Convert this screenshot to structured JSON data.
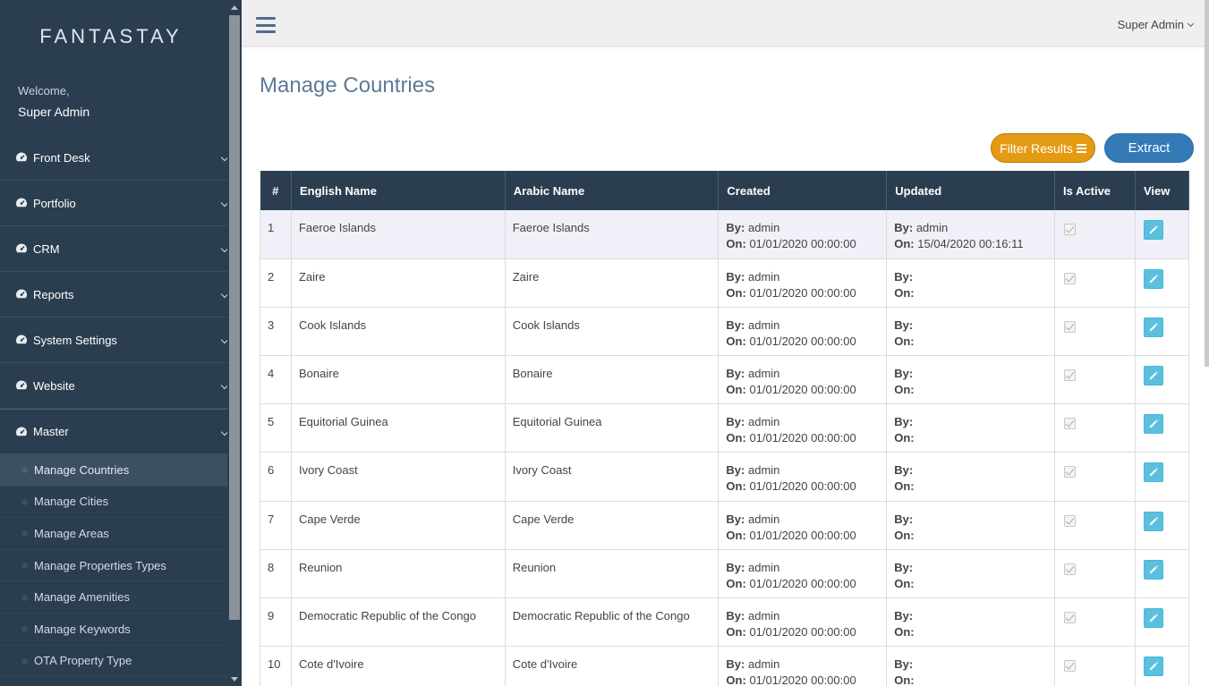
{
  "brand": {
    "logo_text": "FANTASTAY"
  },
  "welcome": {
    "greeting": "Welcome,",
    "user": "Super Admin"
  },
  "sidebar": {
    "items": [
      {
        "label": "Front Desk",
        "icon": "dashboard-icon"
      },
      {
        "label": "Portfolio",
        "icon": "dashboard-icon"
      },
      {
        "label": "CRM",
        "icon": "dashboard-icon"
      },
      {
        "label": "Reports",
        "icon": "dashboard-icon"
      },
      {
        "label": "System Settings",
        "icon": "dashboard-icon"
      },
      {
        "label": "Website",
        "icon": "dashboard-icon"
      },
      {
        "label": "Master",
        "icon": "dashboard-icon"
      }
    ],
    "sub_items": [
      {
        "label": "Manage Countries",
        "active": true
      },
      {
        "label": "Manage Cities"
      },
      {
        "label": "Manage Areas"
      },
      {
        "label": "Manage Properties Types"
      },
      {
        "label": "Manage Amenities"
      },
      {
        "label": "Manage Keywords"
      },
      {
        "label": "OTA Property Type"
      }
    ]
  },
  "topbar": {
    "menu_icon": "hamburger-icon",
    "user_menu": "Super Admin"
  },
  "page": {
    "title": "Manage Countries"
  },
  "actions": {
    "filter_label": "Filter Results",
    "extract_label": "Extract"
  },
  "colors": {
    "sidebar_bg": "#2b3e50",
    "filter_btn": "#e59a14",
    "extract_btn": "#337ab7",
    "view_btn": "#5bc0de",
    "title": "#5e7a96"
  },
  "table": {
    "columns": [
      "#",
      "English Name",
      "Arabic Name",
      "Created",
      "Updated",
      "Is Active",
      "View"
    ],
    "by_label": "By:",
    "on_label": "On:",
    "rows": [
      {
        "num": "1",
        "english": "Faeroe Islands",
        "arabic": "Faeroe Islands",
        "created_by": "admin",
        "created_on": "01/01/2020 00:00:00",
        "updated_by": "admin",
        "updated_on": "15/04/2020 00:16:11"
      },
      {
        "num": "2",
        "english": "Zaire",
        "arabic": "Zaire",
        "created_by": "admin",
        "created_on": "01/01/2020 00:00:00",
        "updated_by": "",
        "updated_on": ""
      },
      {
        "num": "3",
        "english": "Cook Islands",
        "arabic": "Cook Islands",
        "created_by": "admin",
        "created_on": "01/01/2020 00:00:00",
        "updated_by": "",
        "updated_on": ""
      },
      {
        "num": "4",
        "english": "Bonaire",
        "arabic": "Bonaire",
        "created_by": "admin",
        "created_on": "01/01/2020 00:00:00",
        "updated_by": "",
        "updated_on": ""
      },
      {
        "num": "5",
        "english": "Equitorial Guinea",
        "arabic": "Equitorial Guinea",
        "created_by": "admin",
        "created_on": "01/01/2020 00:00:00",
        "updated_by": "",
        "updated_on": ""
      },
      {
        "num": "6",
        "english": "Ivory Coast",
        "arabic": "Ivory Coast",
        "created_by": "admin",
        "created_on": "01/01/2020 00:00:00",
        "updated_by": "",
        "updated_on": ""
      },
      {
        "num": "7",
        "english": "Cape Verde",
        "arabic": "Cape Verde",
        "created_by": "admin",
        "created_on": "01/01/2020 00:00:00",
        "updated_by": "",
        "updated_on": ""
      },
      {
        "num": "8",
        "english": "Reunion",
        "arabic": "Reunion",
        "created_by": "admin",
        "created_on": "01/01/2020 00:00:00",
        "updated_by": "",
        "updated_on": ""
      },
      {
        "num": "9",
        "english": "Democratic Republic of the Congo",
        "arabic": "Democratic Republic of the Congo",
        "created_by": "admin",
        "created_on": "01/01/2020 00:00:00",
        "updated_by": "",
        "updated_on": ""
      },
      {
        "num": "10",
        "english": "Cote d'Ivoire",
        "arabic": "Cote d'Ivoire",
        "created_by": "admin",
        "created_on": "01/01/2020 00:00:00",
        "updated_by": "",
        "updated_on": ""
      }
    ]
  }
}
